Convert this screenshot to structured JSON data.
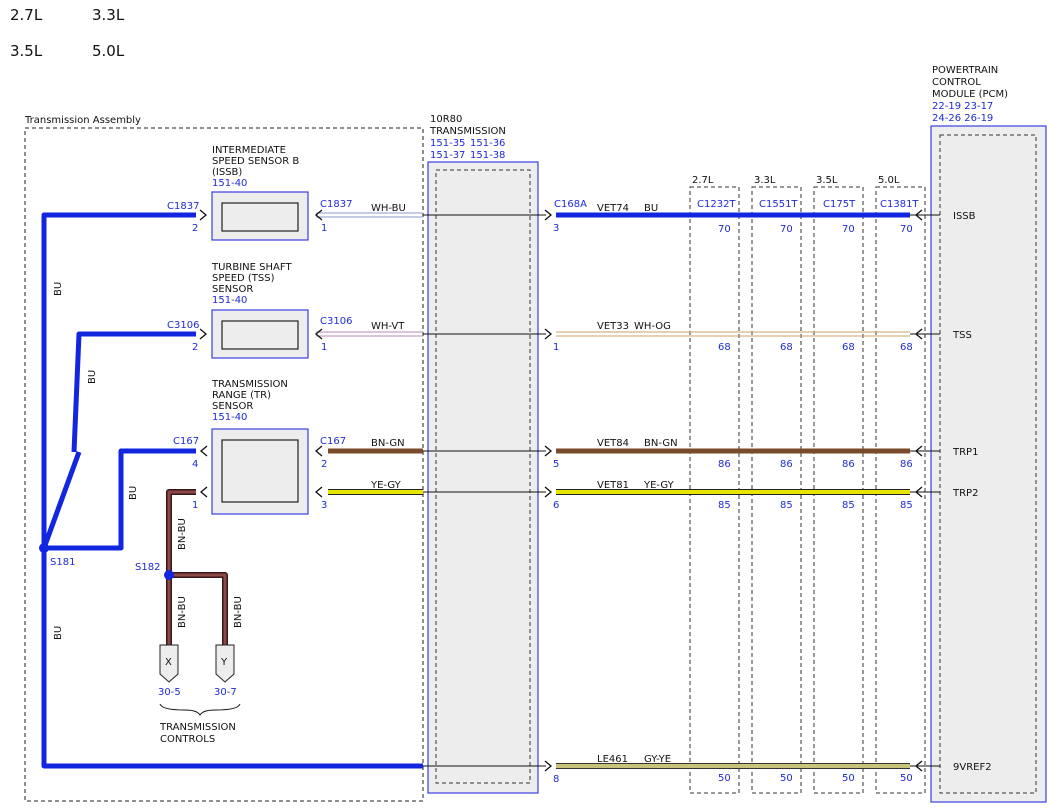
{
  "engine_options": [
    "2.7L",
    "3.3L",
    "3.5L",
    "5.0L"
  ],
  "transmission_assembly": {
    "label": "Transmission Assembly"
  },
  "transmission": {
    "name_line1": "10R80",
    "name_line2": "TRANSMISSION",
    "refs": [
      "151-35",
      "151-36",
      "151-37",
      "151-38"
    ]
  },
  "pcm": {
    "name_lines": [
      "POWERTRAIN",
      "CONTROL",
      "MODULE (PCM)"
    ],
    "refs_line1": "22-19 23-17",
    "refs_line2": "24-26 26-19"
  },
  "sensors": {
    "issb": {
      "lines": [
        "INTERMEDIATE",
        "SPEED SENSOR B",
        "(ISSB)"
      ],
      "ref": "151-40"
    },
    "tss": {
      "lines": [
        "TURBINE SHAFT",
        "SPEED (TSS)",
        "SENSOR"
      ],
      "ref": "151-40"
    },
    "tr": {
      "lines": [
        "TRANSMISSION",
        "RANGE (TR)",
        "SENSOR"
      ],
      "ref": "151-40"
    }
  },
  "connectors": {
    "c1837": "C1837",
    "c3106": "C3106",
    "c167": "C167",
    "c168a": "C168A",
    "engine_connectors": [
      "C1232T",
      "C1551T",
      "C175T",
      "C1381T"
    ]
  },
  "circuits": {
    "issb": {
      "sensor_wire": "WH-BU",
      "pcm_circuit": "VET74",
      "pcm_color": "BU",
      "c168a_pin": "3",
      "sensor_pin": "1",
      "harness_pin": "2",
      "pcm_pins": [
        "70",
        "70",
        "70",
        "70"
      ],
      "pcm_signal": "ISSB"
    },
    "tss": {
      "sensor_wire": "WH-VT",
      "pcm_circuit": "VET33",
      "pcm_color": "WH-OG",
      "c168a_pin": "1",
      "sensor_pin": "1",
      "harness_pin": "2",
      "pcm_pins": [
        "68",
        "68",
        "68",
        "68"
      ],
      "pcm_signal": "TSS"
    },
    "trp1": {
      "sensor_wire": "BN-GN",
      "pcm_circuit": "VET84",
      "pcm_color": "BN-GN",
      "c168a_pin": "5",
      "sensor_pin": "2",
      "harness_pin": "4",
      "pcm_pins": [
        "86",
        "86",
        "86",
        "86"
      ],
      "pcm_signal": "TRP1"
    },
    "trp2": {
      "sensor_wire": "YE-GY",
      "pcm_circuit": "VET81",
      "pcm_color": "YE-GY",
      "c168a_pin": "6",
      "sensor_pin": "3",
      "harness_pin": "1",
      "pcm_pins": [
        "85",
        "85",
        "85",
        "85"
      ],
      "pcm_signal": "TRP2"
    },
    "vref": {
      "pcm_circuit": "LE461",
      "pcm_color": "GY-YE",
      "c168a_pin": "8",
      "pcm_pins": [
        "50",
        "50",
        "50",
        "50"
      ],
      "pcm_signal": "9VREF2"
    }
  },
  "splices": {
    "s181": {
      "label": "S181",
      "wire_color": "BU"
    },
    "s182": {
      "label": "S182",
      "wire_color": "BN-BU"
    }
  },
  "transmission_controls": {
    "label_line1": "TRANSMISSION",
    "label_line2": "CONTROLS",
    "x": {
      "letter": "X",
      "ref": "30-5"
    },
    "y": {
      "letter": "Y",
      "ref": "30-7"
    }
  },
  "colors": {
    "diagram_blue": "#1f2bd6",
    "bu_wire": "#1226e0",
    "bn_gn_wire": "#7a4a2a",
    "ye_gy_wire": "#e0e000",
    "gy_ye_wire": "#b0a848",
    "bn_bu_wire": "#7a3b3b"
  }
}
